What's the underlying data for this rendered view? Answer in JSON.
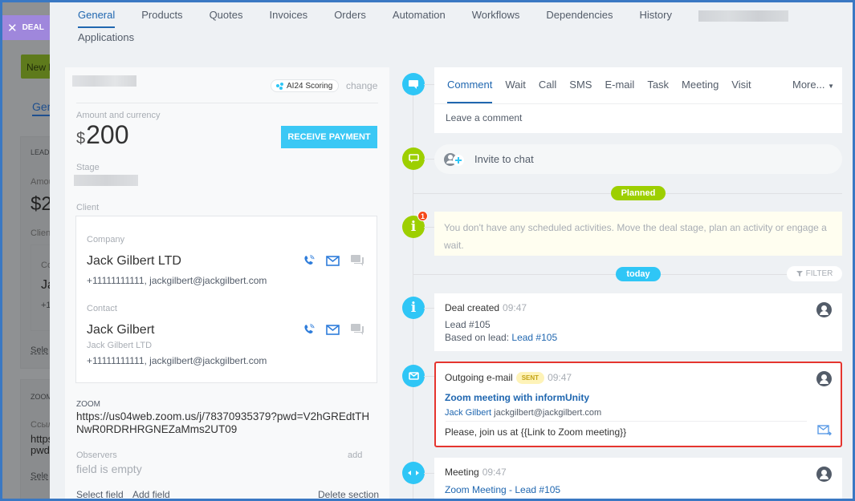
{
  "background": {
    "deal_tab_label": "DEAL",
    "new_lead_button": "New le",
    "general_tab": "Gen",
    "lead_section_label": "LEAD",
    "amount_label": "Amou",
    "amount_value": "$2",
    "client_label": "Clien",
    "company_label": "Co",
    "company_name": "Ja",
    "phone": "+1",
    "select_link": "Sele",
    "zoom_section_label": "ZOOM",
    "link_label": "Ссыл",
    "url_line1": "https",
    "url_line2": "pwd",
    "select_link_2": "Sele"
  },
  "tabs": [
    {
      "label": "General",
      "active": true
    },
    {
      "label": "Products"
    },
    {
      "label": "Quotes"
    },
    {
      "label": "Invoices"
    },
    {
      "label": "Orders"
    },
    {
      "label": "Automation"
    },
    {
      "label": "Workflows"
    },
    {
      "label": "Dependencies"
    },
    {
      "label": "History"
    },
    {
      "label": "Applications"
    }
  ],
  "left": {
    "ai_scoring": "AI24 Scoring",
    "change": "change",
    "amount_label": "Amount and currency",
    "currency_symbol": "$",
    "amount": "200",
    "receive_payment": "RECEIVE PAYMENT",
    "stage_label": "Stage",
    "client_label": "Client",
    "company": {
      "label": "Company",
      "name": "Jack Gilbert LTD",
      "details": "+11111111111, jackgilbert@jackgilbert.com"
    },
    "contact": {
      "label": "Contact",
      "name": "Jack Gilbert",
      "company": "Jack Gilbert LTD",
      "details": "+11111111111, jackgilbert@jackgilbert.com"
    },
    "zoom_label": "ZOOM",
    "zoom_url": "https://us04web.zoom.us/j/78370935379?pwd=V2hGREdtTHNwR0RDRHRGNEZaMms2UT09",
    "observers_label": "Observers",
    "observers_add": "add",
    "observers_empty": "field is empty",
    "select_field": "Select field",
    "add_field": "Add field",
    "delete_section": "Delete section"
  },
  "timeline": {
    "editor_tabs": [
      {
        "label": "Comment",
        "active": true
      },
      {
        "label": "Wait"
      },
      {
        "label": "Call"
      },
      {
        "label": "SMS"
      },
      {
        "label": "E-mail"
      },
      {
        "label": "Task"
      },
      {
        "label": "Meeting"
      },
      {
        "label": "Visit"
      }
    ],
    "more": "More...",
    "comment_placeholder": "Leave a comment",
    "invite_to_chat": "Invite to chat",
    "planned_pill": "Planned",
    "planned_badge": "1",
    "planned_message": "You don't have any scheduled activities. Move the deal stage, plan an activity or engage a wait.",
    "today_pill": "today",
    "filter": "FILTER",
    "deal_created": {
      "title": "Deal created",
      "time": "09:47",
      "line1": "Lead #105",
      "based_on_label": "Based on lead:",
      "based_on_link": "Lead #105"
    },
    "email": {
      "title": "Outgoing e-mail",
      "status": "SENT",
      "time": "09:47",
      "subject": "Zoom meeting with informUnity",
      "to_name": "Jack Gilbert",
      "to_email": "jackgilbert@jackgilbert.com",
      "body": "Please, join us at {{Link to Zoom meeting}}"
    },
    "meeting": {
      "title": "Meeting",
      "time": "09:47",
      "link": "Zoom Meeting - Lead #105"
    }
  },
  "colors": {
    "accent_blue": "#2067b0",
    "timeline_blue": "#2fc6f6",
    "timeline_green": "#9dcf00",
    "highlight_red": "#e5352f",
    "deal_purple": "#9f87dc"
  }
}
